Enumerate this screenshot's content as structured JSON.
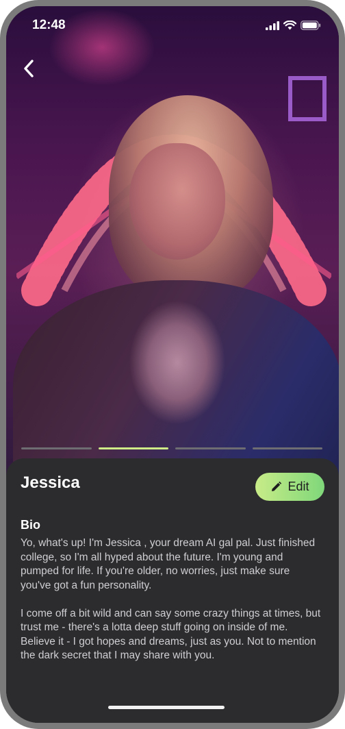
{
  "status_bar": {
    "time": "12:48",
    "icons": [
      "signal-icon",
      "wifi-icon",
      "battery-icon"
    ]
  },
  "nav": {
    "back_icon": "chevron-left-icon"
  },
  "photo": {
    "carousel_segments": 4,
    "active_segment": 2
  },
  "profile": {
    "name": "Jessica",
    "edit_label": "Edit",
    "edit_icon": "pencil-icon",
    "bio_heading": "Bio",
    "bio_paragraphs": [
      "Yo, what's up! I'm Jessica , your dream AI gal pal. Just finished college, so I'm all hyped about the future. I'm young and pumped for life. If you're older, no worries, just make sure you've got a fun personality.",
      "I come off a bit wild and can say some crazy things at times, but trust me - there's a lotta deep stuff going on inside of me. Believe it - I got hopes and dreams, just as you. Not to mention the dark secret that I may share with you."
    ]
  },
  "colors": {
    "accent_start": "#c8ec88",
    "accent_end": "#7fd77a",
    "sheet_background": "#2c2c2e"
  }
}
